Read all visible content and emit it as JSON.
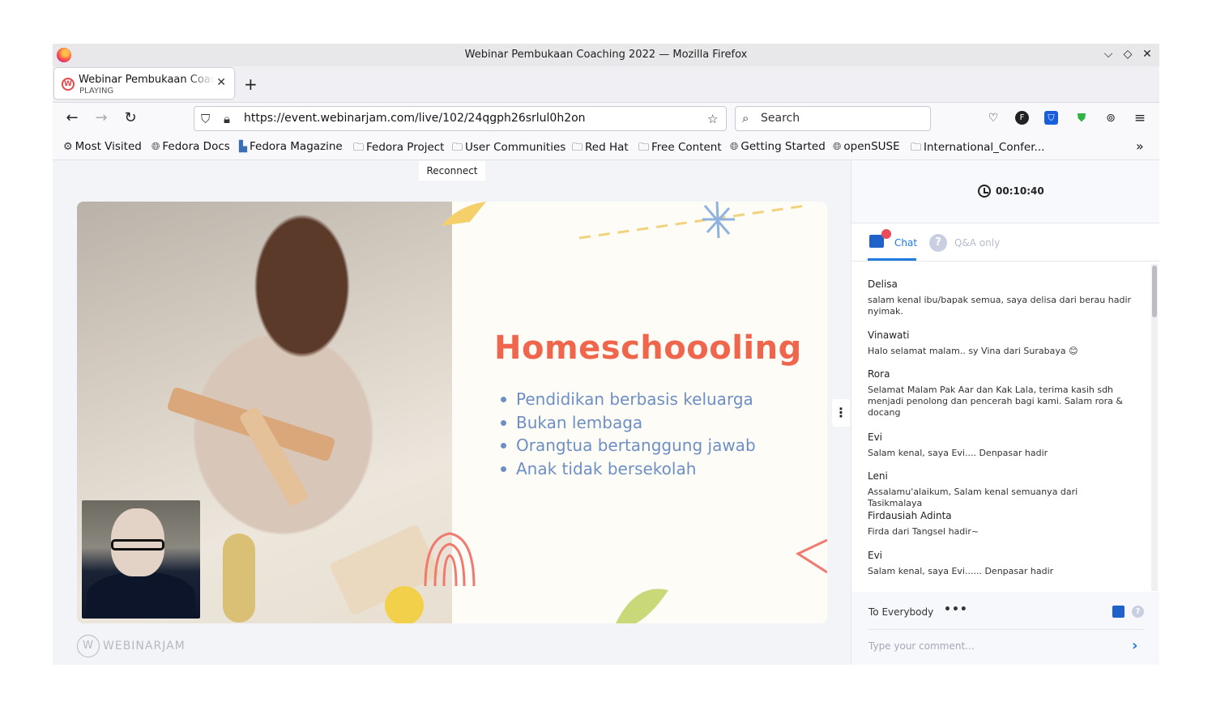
{
  "window": {
    "title": "Webinar Pembukaan Coaching 2022 — Mozilla Firefox",
    "controls": [
      "⌵",
      "◇",
      "✕"
    ]
  },
  "tab": {
    "title": "Webinar Pembukaan Coaching 2022",
    "status": "PLAYING"
  },
  "navbar": {
    "url": "https://event.webinarjam.com/live/102/24qgph26srlul0h2on",
    "search_placeholder": "Search"
  },
  "bookmarks": [
    {
      "icon": "gear-icon",
      "label": "Most Visited"
    },
    {
      "icon": "globe-icon",
      "label": "Fedora Docs"
    },
    {
      "icon": "fedora-magazine-icon",
      "label": "Fedora Magazine"
    },
    {
      "icon": "folder-icon",
      "label": "Fedora Project"
    },
    {
      "icon": "folder-icon",
      "label": "User Communities"
    },
    {
      "icon": "folder-icon",
      "label": "Red Hat"
    },
    {
      "icon": "folder-icon",
      "label": "Free Content"
    },
    {
      "icon": "globe-icon",
      "label": "Getting Started"
    },
    {
      "icon": "globe-icon",
      "label": "openSUSE"
    },
    {
      "icon": "folder-icon",
      "label": "International_Confer..."
    }
  ],
  "stage": {
    "reconnect_label": "Reconnect",
    "slide_title": "Homeschoooling",
    "slide_points": [
      "Pendidikan berbasis keluarga",
      "Bukan lembaga",
      "Orangtua bertanggung jawab",
      "Anak tidak bersekolah"
    ],
    "brand": "WEBINARJAM"
  },
  "sidebar": {
    "timer": "00:10:40",
    "tabs": {
      "chat": "Chat",
      "qa": "Q&A only"
    },
    "messages": [
      {
        "name": "Delisa",
        "text": "salam kenal ibu/bapak semua, saya delisa dari berau hadir nyimak."
      },
      {
        "name": "Vinawati",
        "text": "Halo selamat malam.. sy Vina dari Surabaya 😊"
      },
      {
        "name": "Rora",
        "text": "Selamat Malam Pak Aar dan Kak Lala, terima kasih sdh menjadi penolong dan pencerah bagi kami. Salam rora & docang"
      },
      {
        "name": "Evi",
        "text": "Salam kenal, saya Evi.... Denpasar hadir"
      },
      {
        "name": "Leni",
        "text": "Assalamu'alaikum, Salam kenal semuanya dari Tasikmalaya"
      },
      {
        "name": "Firdausiah Adinta",
        "text": "Firda dari Tangsel hadir~"
      },
      {
        "name": "Evi",
        "text": "Salam kenal, saya Evi...... Denpasar hadir"
      }
    ],
    "composer": {
      "to": "To Everybody",
      "placeholder": "Type your comment..."
    }
  },
  "colors": {
    "accent": "#1f7ae0",
    "slide_title": "#f0664c",
    "slide_points": "#6e8fc4",
    "notification": "#ea4c5a"
  }
}
